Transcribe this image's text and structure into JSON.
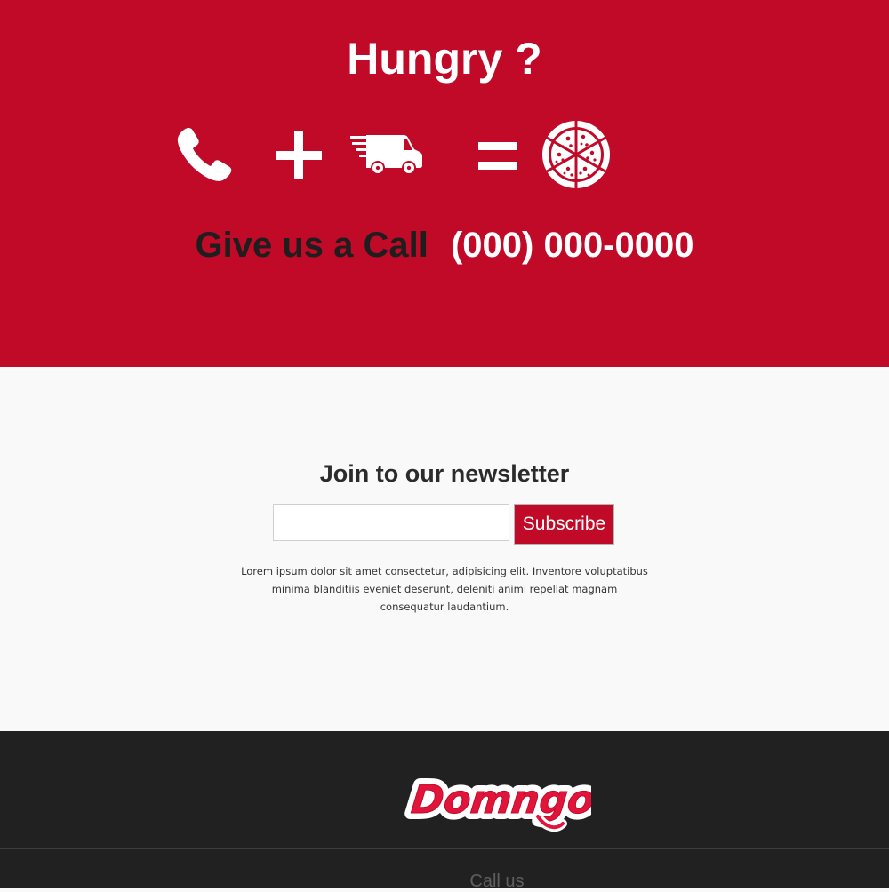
{
  "hero": {
    "title": "Hungry ?",
    "equation": {
      "icons": [
        "phone-icon",
        "plus-icon",
        "delivery-truck-icon",
        "equals-icon",
        "pizza-icon"
      ]
    },
    "call_label": "Give us a Call",
    "phone": "(000) 000-0000"
  },
  "newsletter": {
    "title": "Join to our newsletter",
    "email_value": "",
    "email_placeholder": "",
    "subscribe_label": "Subscribe",
    "description": "Lorem ipsum dolor sit amet consectetur, adipisicing elit. Inventore voluptatibus minima blanditiis eveniet deserunt, deleniti animi repellat magnam consequatur laudantium."
  },
  "footer": {
    "logo_text": "Domngo",
    "call_us": "Call us"
  },
  "colors": {
    "brand_red": "#c00a27",
    "footer_bg": "#212121",
    "page_bg": "#f9f9f9"
  }
}
